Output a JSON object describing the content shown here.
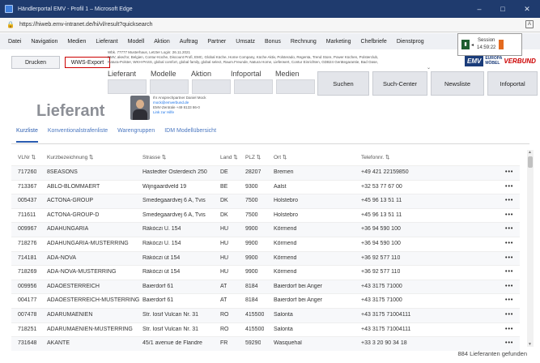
{
  "window": {
    "title": "Händlerportal EMV - Profil 1 – Microsoft Edge",
    "minimize": "–",
    "maximize": "□",
    "close": "✕"
  },
  "address": {
    "url": "https://hiweb.emv-intranet.de/hi/vl/result?quicksearch"
  },
  "menu": [
    "Datei",
    "Navigation",
    "Medien",
    "Lieferant",
    "Modell",
    "Aktion",
    "Auftrag",
    "Partner",
    "Umsatz",
    "Bonus",
    "Rechnung",
    "Marketing",
    "Chefbriefe",
    "Dienstprog"
  ],
  "session": {
    "label": "Session",
    "time": "14:59:22"
  },
  "toolbar": {
    "print_label": "Drucken",
    "export_label": "WWS-Export"
  },
  "info": {
    "line1": "Wbk. 77777 Musterhaus, Letzter Login: 26.11.2021",
    "line2": "EMV, aked'or, Belgien, Contur-Küche, Discount Profi, EMC, Global Küche, Home Company, Küche Aktiv, Polsterado, Regenta, Trend Store, Power Küchen, Polsterclub,",
    "line3": "Natura-Polster, WKH-PASS, global comfort, global family, global select, Raum.Freunde, Natura Home, Lieferwert, Contur Einrichten, GDB24 Gerätegarantie, Bad Oase,"
  },
  "subnav": {
    "lieferant": "Lieferant",
    "modelle": "Modelle",
    "aktion": "Aktion",
    "infoportal": "Infoportal",
    "medien": "Medien"
  },
  "actions": {
    "suchen": "Suchen",
    "such_center": "Such-Center",
    "newsliste": "Newsliste",
    "infoportal": "Infoportal"
  },
  "logo": {
    "emv": "EMV",
    "europa": "EUROPA",
    "moebel": "MÖBEL",
    "verbund": "VERBUND"
  },
  "page": {
    "title": "Lieferant"
  },
  "contact": {
    "line1": "Ihr Ansprechpartner   Daniel Mock",
    "line2": "mock@emverbund.de",
    "line3": "EMV-Zentrale    +49 8133 86-0",
    "line4": "Link zur Hilfe"
  },
  "tabs": [
    "Kurzliste",
    "Konventionalstrafenliste",
    "Warengruppen",
    "IDM Modellübersicht"
  ],
  "table": {
    "headers": {
      "vlnr": "VLNr ⇅",
      "kurz": "Kurzbezeichnung ⇅",
      "strasse": "Strasse ⇅",
      "land": "Land ⇅",
      "plz": "PLZ ⇅",
      "ort": "Ort ⇅",
      "tel": "Telefonnr. ⇅"
    },
    "rows": [
      {
        "vlnr": "717260",
        "name": "8SEASONS",
        "strasse": "Hastedter Osterdeich 250",
        "land": "DE",
        "plz": "28207",
        "ort": "Bremen",
        "tel": "+49 421 22159850"
      },
      {
        "vlnr": "713367",
        "name": "ABLO-BLOMMAERT",
        "strasse": "Wijngaardveld 19",
        "land": "BE",
        "plz": "9300",
        "ort": "Aalst",
        "tel": "+32 53 77 67 00"
      },
      {
        "vlnr": "005437",
        "name": "ACTONA-GROUP",
        "strasse": "Smedegaardvej 6 A, Tvis",
        "land": "DK",
        "plz": "7500",
        "ort": "Holstebro",
        "tel": "+45 96 13 51 11"
      },
      {
        "vlnr": "711611",
        "name": "ACTONA-GROUP-D",
        "strasse": "Smedegaardvej 6 A, Tvis",
        "land": "DK",
        "plz": "7500",
        "ort": "Holstebro",
        "tel": "+45 96 13 51 11"
      },
      {
        "vlnr": "009967",
        "name": "ADAHUNGARIA",
        "strasse": "Rákóczi U. 154",
        "land": "HU",
        "plz": "9900",
        "ort": "Körmend",
        "tel": "+36 94 590 100"
      },
      {
        "vlnr": "718276",
        "name": "ADAHUNGARIA-MUSTERRING",
        "strasse": "Rákóczi U. 154",
        "land": "HU",
        "plz": "9900",
        "ort": "Körmend",
        "tel": "+36 94 590 100"
      },
      {
        "vlnr": "714181",
        "name": "ADA-NOVA",
        "strasse": "Rákóczi út 154",
        "land": "HU",
        "plz": "9900",
        "ort": "Körmend",
        "tel": "+36 92 577 110"
      },
      {
        "vlnr": "718269",
        "name": "ADA-NOVA-MUSTERRING",
        "strasse": "Rákóczi út 154",
        "land": "HU",
        "plz": "9900",
        "ort": "Körmend",
        "tel": "+36 92 577 110"
      },
      {
        "vlnr": "009956",
        "name": "ADAOESTERREICH",
        "strasse": "Baierdorf 61",
        "land": "AT",
        "plz": "8184",
        "ort": "Baierdorf bei Anger",
        "tel": "+43 3175 71000"
      },
      {
        "vlnr": "004177",
        "name": "ADAOESTERREICH-MUSTERRING",
        "strasse": "Baierdorf 61",
        "land": "AT",
        "plz": "8184",
        "ort": "Baierdorf bei Anger",
        "tel": "+43 3175 71000"
      },
      {
        "vlnr": "007478",
        "name": "ADARUMAENIEN",
        "strasse": "Str. Iosif Vulcan Nr. 31",
        "land": "RO",
        "plz": "415500",
        "ort": "Salonta",
        "tel": "+43 3175 71004111"
      },
      {
        "vlnr": "718251",
        "name": "ADARUMAENIEN-MUSTERRING",
        "strasse": "Str. Iosif Vulcan Nr. 31",
        "land": "RO",
        "plz": "415500",
        "ort": "Salonta",
        "tel": "+43 3175 71004111"
      },
      {
        "vlnr": "731648",
        "name": "AKANTE",
        "strasse": "45/1 avenue de Flandre",
        "land": "FR",
        "plz": "59290",
        "ort": "Wasquehal",
        "tel": "+33 3 20 90 34 18"
      }
    ],
    "row_menu": "•••"
  },
  "footer": {
    "count_text": "884 Lieferanten gefunden"
  }
}
